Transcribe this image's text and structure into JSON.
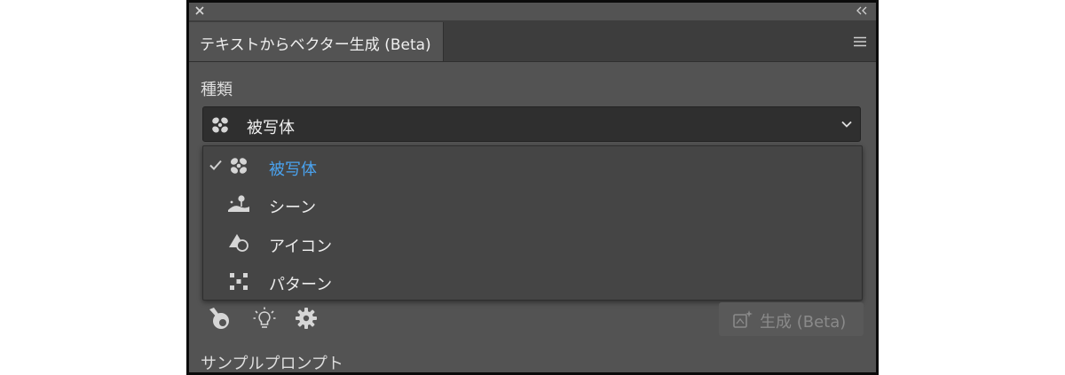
{
  "panel": {
    "tab_title": "テキストからベクター生成 (Beta)",
    "icons": {
      "close": "close-icon",
      "collapse": "double-chevron-left-icon",
      "menu": "hamburger-menu-icon"
    }
  },
  "type_section": {
    "label": "種類",
    "selected": {
      "label": "被写体",
      "icon": "subject-icon"
    }
  },
  "menu": {
    "items": [
      {
        "label": "被写体",
        "icon": "subject-icon",
        "checked": true
      },
      {
        "label": "シーン",
        "icon": "scene-icon",
        "checked": false
      },
      {
        "label": "アイコン",
        "icon": "icon-shapes-icon",
        "checked": false
      },
      {
        "label": "パターン",
        "icon": "pattern-icon",
        "checked": false
      }
    ]
  },
  "toolbar": {
    "icons": [
      "style-picker-icon",
      "lightbulb-icon",
      "gear-icon"
    ],
    "generate_label": "生成 (Beta)",
    "generate_icon": "sparkle-frame-icon"
  },
  "sample": {
    "label": "サンプルプロンプト"
  },
  "colors": {
    "panel_bg": "#535353",
    "accent": "#4aa3f0",
    "dropdown_bg": "#2f2f2f",
    "menu_bg": "#454545"
  }
}
